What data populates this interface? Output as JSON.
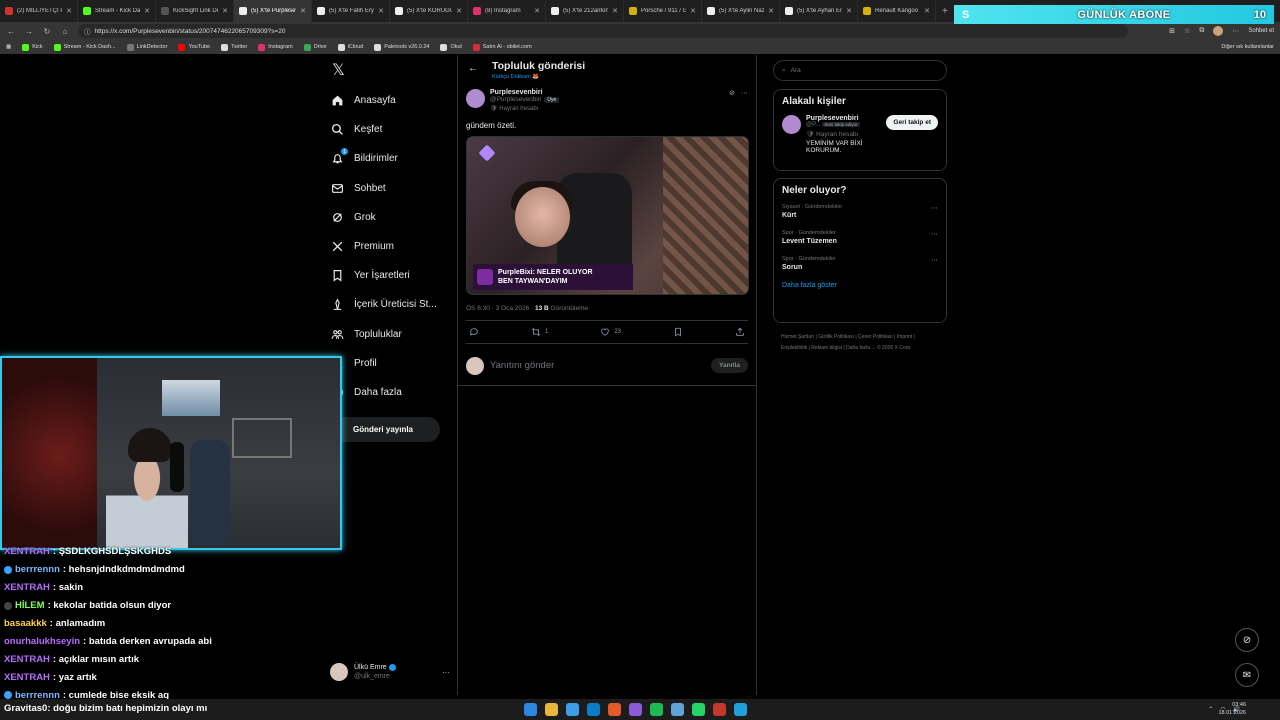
{
  "browser": {
    "tabs": [
      {
        "label": "(2) MİLLİYETÇİ PA",
        "color": "#c33"
      },
      {
        "label": "Stream - Kick Dash",
        "color": "#53fc18"
      },
      {
        "label": "KickSight Link Dete",
        "color": "#555"
      },
      {
        "label": "(5) X'te Purplesev",
        "color": "#eee",
        "active": true
      },
      {
        "label": "(5) X'te Fatih Eryo",
        "color": "#eee"
      },
      {
        "label": "(5) X'te KÖRÜĞÜ \"",
        "color": "#eee"
      },
      {
        "label": "(8) Instagram",
        "color": "#e1306c"
      },
      {
        "label": "(5) X'te 212antoni",
        "color": "#eee"
      },
      {
        "label": "Porsche / 911 / GT",
        "color": "#d4b106"
      },
      {
        "label": "(5) X'te Aylin Naz",
        "color": "#eee"
      },
      {
        "label": "(5) X'te Ayhan Erk",
        "color": "#eee"
      },
      {
        "label": "Renault Kangoo 1.",
        "color": "#d4b106"
      }
    ],
    "url": "https://x.com/Purplesevenbiri/status/2007474622065709309?s=20",
    "sohbet_label": "Sohbet et",
    "bookmarks": [
      {
        "label": "Kick",
        "color": "#53fc18"
      },
      {
        "label": "Stream - Kick Dash...",
        "color": "#53fc18"
      },
      {
        "label": "LinkDetector",
        "color": "#777"
      },
      {
        "label": "YouTube",
        "color": "#f00"
      },
      {
        "label": "Twitter",
        "color": "#ddd"
      },
      {
        "label": "Instagram",
        "color": "#e1306c"
      },
      {
        "label": "Drive",
        "color": "#34a853"
      },
      {
        "label": "iCloud",
        "color": "#ddd"
      },
      {
        "label": "Paletools v26.0.24",
        "color": "#ddd"
      },
      {
        "label": "Okul",
        "color": "#ddd"
      },
      {
        "label": "Satın Al - obilet.com",
        "color": "#c33"
      }
    ],
    "bookmarks_other": "Diğer sık kullanılanlar"
  },
  "overlay": {
    "s_label": "S",
    "title": "GÜNLÜK ABONE",
    "count": "10"
  },
  "nav": {
    "items": [
      {
        "label": "Anasayfa",
        "icon": "home-icon"
      },
      {
        "label": "Keşfet",
        "icon": "search-icon"
      },
      {
        "label": "Bildirimler",
        "icon": "bell-icon",
        "badge": "1"
      },
      {
        "label": "Sohbet",
        "icon": "mail-icon"
      },
      {
        "label": "Grok",
        "icon": "grok-icon"
      },
      {
        "label": "Premium",
        "icon": "x-icon"
      },
      {
        "label": "Yer İşaretleri",
        "icon": "bookmark-icon"
      },
      {
        "label": "İçerik Üreticisi St...",
        "icon": "creator-icon"
      },
      {
        "label": "Topluluklar",
        "icon": "communities-icon"
      },
      {
        "label": "Profil",
        "icon": "profile-icon"
      },
      {
        "label": "Daha fazla",
        "icon": "more-icon"
      }
    ],
    "post_button": "Gönderi yayınla",
    "account_name": "Ülkü Emre",
    "account_handle": "@ulk_emre"
  },
  "post_page": {
    "title": "Topluluk gönderisi",
    "community": "Kürkçü Dükkanı 🦊",
    "author_name": "Purplesevenbiri",
    "author_handle": "@Purplesevenbiri",
    "member_badge": "Üye",
    "fan_label": "Hayran hesabı",
    "text": "gündem özeti.",
    "media_caption_line1": "PurpleBixi: NELER OLUYOR",
    "media_caption_line2": "BEN TAYWAN'DAYIM",
    "time": "ÖS 6:30 · 3 Oca 2026 · ",
    "views": "13 B",
    "views_label": " Görüntüleme",
    "retweets": "1",
    "likes": "23",
    "reply_placeholder": "Yanıtını gönder",
    "reply_button": "Yanıtla"
  },
  "sidebar": {
    "search_placeholder": "Ara",
    "related_title": "Alakalı kişiler",
    "related_name": "Purplesevenbiri",
    "related_handle": "@P...",
    "related_follows": "Seni takip ediyor",
    "related_fan": "Hayran hesabı",
    "related_bio": "YEMİNİM VAR BİXİ KORURUM.",
    "follow_button": "Geri takip et",
    "trends_title": "Neler oluyor?",
    "trends": [
      {
        "category": "Siyaset · Gündemdekiler",
        "name": "Kürt"
      },
      {
        "category": "Spor · Gündemdekiler",
        "name": "Levent Tüzemen"
      },
      {
        "category": "Spor · Gündemdekiler",
        "name": "Sorun"
      }
    ],
    "show_more": "Daha fazla göster",
    "footer": "Hizmet Şartları | Gizlilik Politikası | Çerez Politikası | Imprint | Erişilebilirlik | Reklam bilgisi | Daha fazla ... © 2026 X Corp."
  },
  "chat": [
    {
      "user": "XENTRAH",
      "msg": ": ŞSDLKGHSDLŞSKGHDS",
      "color": "#b66cff",
      "badge": ""
    },
    {
      "user": "berrrennn",
      "msg": ": hehsnjdndkdmdmdmdmd",
      "color": "#7fb8ff",
      "badge": "#3aa3ff"
    },
    {
      "user": "XENTRAH",
      "msg": ": sakin",
      "color": "#b66cff",
      "badge": ""
    },
    {
      "user": "HİLEM",
      "msg": ": kekolar batida olsun diyor",
      "color": "#7dff5a",
      "badge": "#444"
    },
    {
      "user": "basaakkk",
      "msg": ": anlamadım",
      "color": "#ffd24d",
      "badge": ""
    },
    {
      "user": "onurhalukhseyin",
      "msg": ": batıda derken avrupada abi",
      "color": "#b66cff",
      "badge": ""
    },
    {
      "user": "XENTRAH",
      "msg": ": açıklar mısın artık",
      "color": "#b66cff",
      "badge": ""
    },
    {
      "user": "XENTRAH",
      "msg": ": yaz artık",
      "color": "#b66cff",
      "badge": ""
    },
    {
      "user": "berrrennn",
      "msg": ": cumlede bise eksik aq",
      "color": "#7fb8ff",
      "badge": "#3aa3ff"
    }
  ],
  "last_chat": {
    "user": "Gravitas0",
    "msg": ": doğu bizim batı hepimizin olayı mı"
  },
  "taskbar": {
    "time": "03:46",
    "date": "18.01.2026"
  }
}
